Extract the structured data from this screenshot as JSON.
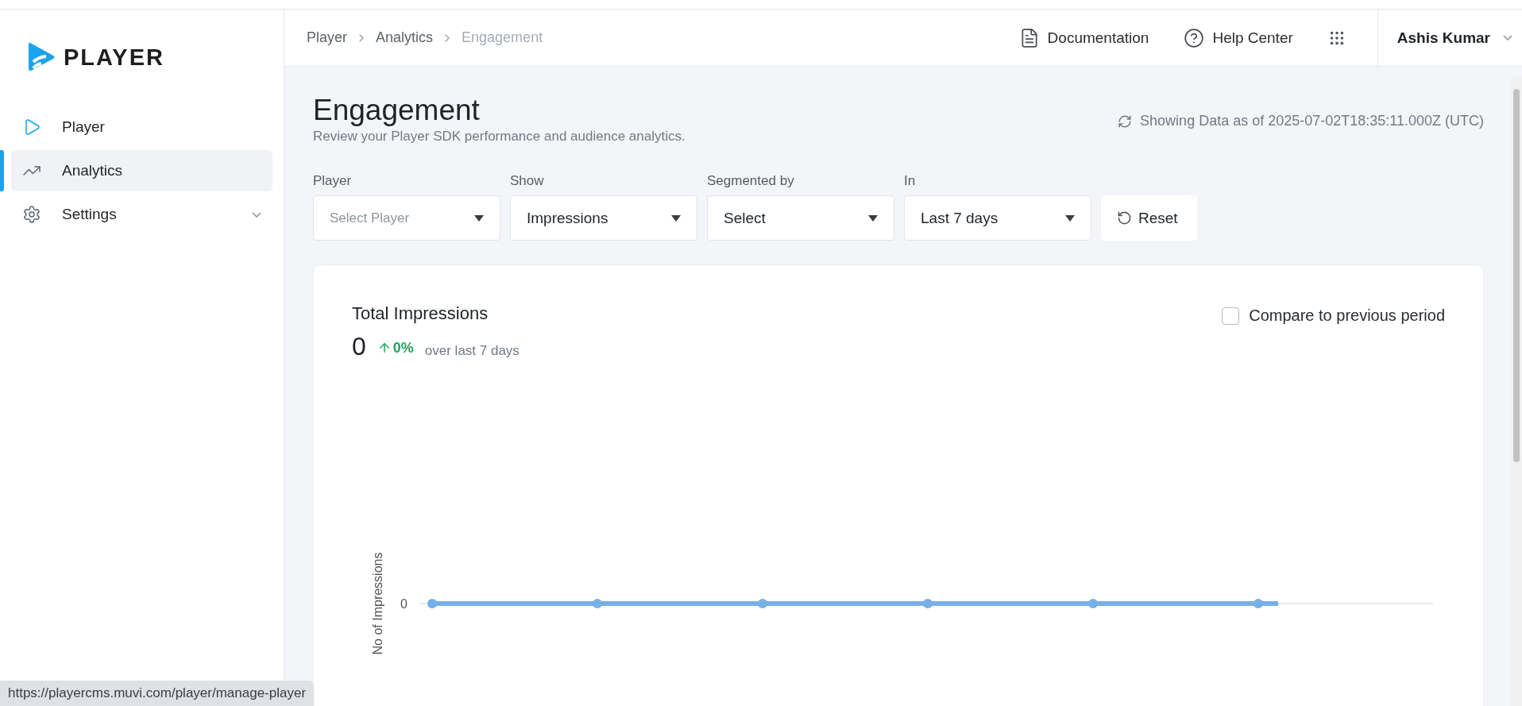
{
  "logo": {
    "text": "PLAYER"
  },
  "sidebar": {
    "items": [
      {
        "label": "Player",
        "kind": "link",
        "selected": false
      },
      {
        "label": "Analytics",
        "kind": "link",
        "selected": true
      },
      {
        "label": "Settings",
        "kind": "group",
        "selected": false,
        "expanded": false
      }
    ]
  },
  "breadcrumb": [
    {
      "label": "Player",
      "current": false
    },
    {
      "label": "Analytics",
      "current": false
    },
    {
      "label": "Engagement",
      "current": true
    }
  ],
  "header": {
    "links": [
      "Documentation",
      "Help Center"
    ],
    "user": "Ashis Kumar"
  },
  "page": {
    "title": "Engagement",
    "subtitle": "Review your Player SDK performance and audience analytics.",
    "data_timestamp": "Showing Data as of 2025-07-02T18:35:11.000Z (UTC)"
  },
  "filters": [
    {
      "label": "Player",
      "placeholder": "Select Player"
    },
    {
      "label": "Show",
      "value": "Impressions"
    },
    {
      "label": "Segmented by",
      "value": "Select"
    },
    {
      "label": "In",
      "value": "Last 7 days"
    }
  ],
  "reset_button": "Reset",
  "card": {
    "title": "Total Impressions",
    "total": "0",
    "change": "0%",
    "period": "over last 7 days",
    "compare": {
      "label": "Compare to previous period",
      "checked": false
    },
    "chart": {
      "ylabel": "No of Impressions",
      "y_tick_label": "0"
    }
  },
  "status_url": "https://playercms.muvi.com/player/manage-player"
}
